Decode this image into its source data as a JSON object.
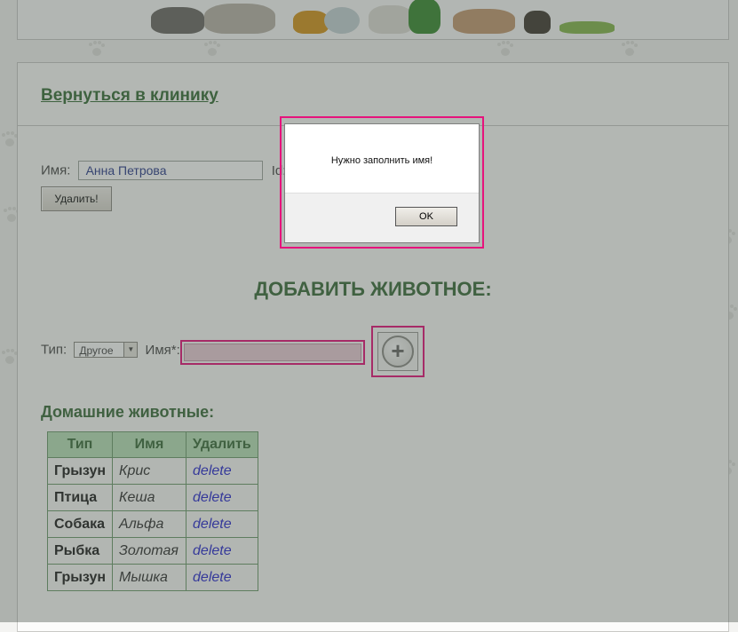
{
  "header": {
    "banner_icon": "pets-banner"
  },
  "nav": {
    "back_link": "Вернуться в клинику"
  },
  "owner": {
    "name_label": "Имя:",
    "name_value": "Анна Петрова",
    "id_label": "Id: X",
    "delete_button": "Удалить!"
  },
  "add_pet": {
    "title": "ДОБАВИТЬ ЖИВОТНОЕ:",
    "type_label": "Тип:",
    "type_selected": "Другое",
    "name_label": "Имя*:",
    "name_value": "",
    "add_icon": "+"
  },
  "pets": {
    "title": "Домашние животные:",
    "columns": [
      "Тип",
      "Имя",
      "Удалить"
    ],
    "rows": [
      {
        "type": "Грызун",
        "name": "Крис",
        "action": "delete"
      },
      {
        "type": "Птица",
        "name": "Кеша",
        "action": "delete"
      },
      {
        "type": "Собака",
        "name": "Альфа",
        "action": "delete"
      },
      {
        "type": "Рыбка",
        "name": "Золотая",
        "action": "delete"
      },
      {
        "type": "Грызун",
        "name": "Мышка",
        "action": "delete"
      }
    ]
  },
  "dialog": {
    "message": "Нужно заполнить имя!",
    "ok_button": "OK"
  },
  "colors": {
    "accent_green": "#3d6d3d",
    "highlight_pink": "#e6137c",
    "header_green": "#b9e2b9",
    "link_blue": "#2a2ad0"
  }
}
